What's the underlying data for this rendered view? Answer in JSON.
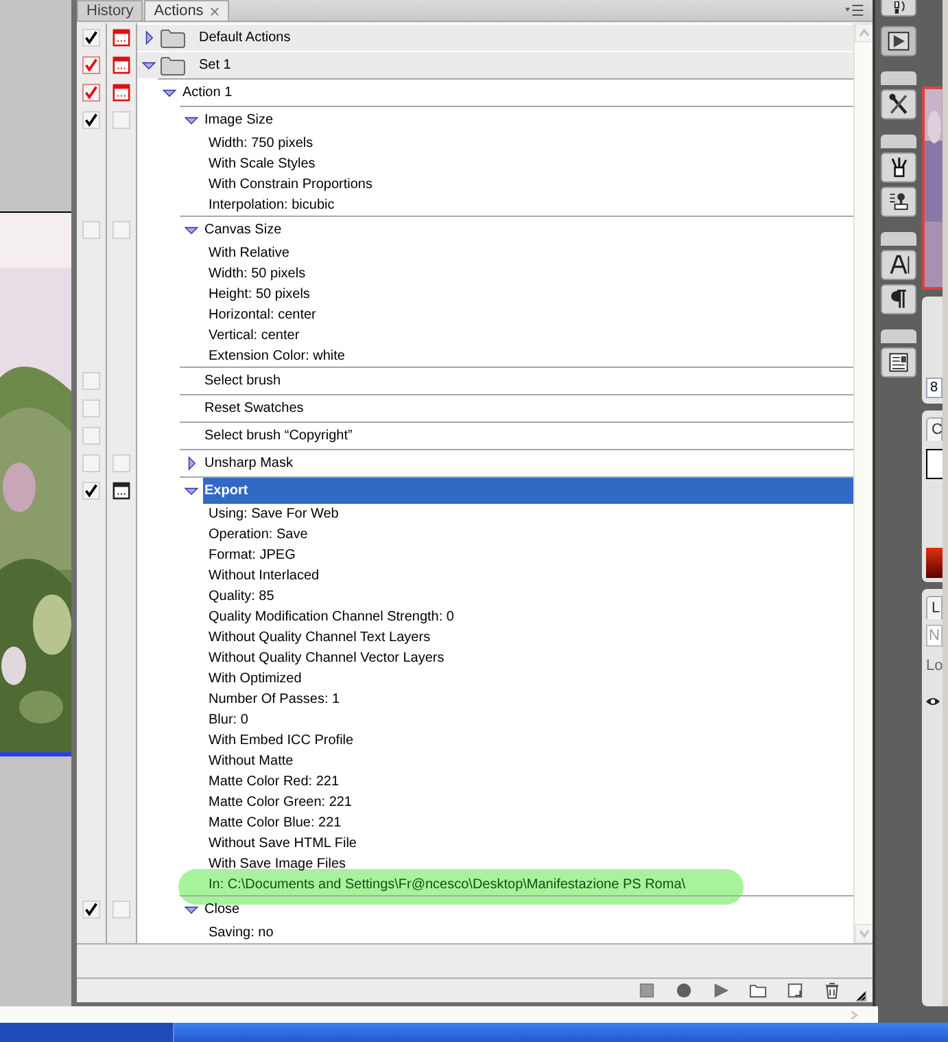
{
  "tabs": [
    {
      "label": "History",
      "selected": false,
      "closable": false
    },
    {
      "label": "Actions",
      "selected": true,
      "closable": true
    }
  ],
  "sets": [
    {
      "name": "Default Actions",
      "checked": true,
      "mixed": false,
      "dialog_toggle": {
        "on": true,
        "mixed": true
      },
      "expanded": false,
      "selected": false
    },
    {
      "name": "Set 1",
      "checked": true,
      "mixed": true,
      "dialog_toggle": {
        "on": true,
        "mixed": true
      },
      "expanded": true,
      "selected": false,
      "children": [
        {
          "name": "Action 1",
          "checked": true,
          "mixed": true,
          "dialog_toggle": {
            "on": true,
            "mixed": true
          },
          "expanded": true,
          "selected": false,
          "children": [
            {
              "name": "Image Size",
              "checked": true,
              "mixed": false,
              "dialog_toggle": {
                "on": false,
                "mixed": false
              },
              "expanded": true,
              "selected": false,
              "params": [
                {
                  "text": "Width: 750 pixels",
                  "highlighted": false
                },
                {
                  "text": "With Scale Styles",
                  "highlighted": false
                },
                {
                  "text": "With Constrain Proportions",
                  "highlighted": false
                },
                {
                  "text": "Interpolation: bicubic",
                  "highlighted": false
                }
              ]
            },
            {
              "name": "Canvas Size",
              "checked": false,
              "mixed": false,
              "dialog_toggle": {
                "on": false,
                "mixed": false
              },
              "expanded": true,
              "selected": false,
              "params": [
                {
                  "text": "With Relative",
                  "highlighted": false
                },
                {
                  "text": "Width: 50 pixels",
                  "highlighted": false
                },
                {
                  "text": "Height: 50 pixels",
                  "highlighted": false
                },
                {
                  "text": "Horizontal: center",
                  "highlighted": false
                },
                {
                  "text": "Vertical: center",
                  "highlighted": false
                },
                {
                  "text": "Extension Color: white",
                  "highlighted": false
                }
              ]
            },
            {
              "name": "Select brush",
              "checked": false,
              "mixed": false,
              "selected": false
            },
            {
              "name": "Reset Swatches",
              "checked": false,
              "mixed": false,
              "selected": false
            },
            {
              "name": "Select brush “Copyright”",
              "checked": false,
              "mixed": false,
              "selected": false
            },
            {
              "name": "Unsharp Mask",
              "checked": false,
              "mixed": false,
              "dialog_toggle": {
                "on": false,
                "mixed": false
              },
              "expanded": false,
              "selected": false
            },
            {
              "name": "Export",
              "checked": true,
              "mixed": false,
              "dialog_toggle": {
                "on": true,
                "mixed": false
              },
              "expanded": true,
              "selected": true,
              "params": [
                {
                  "text": "Using: Save For Web",
                  "highlighted": false
                },
                {
                  "text": "Operation: Save",
                  "highlighted": false
                },
                {
                  "text": "Format: JPEG",
                  "highlighted": false
                },
                {
                  "text": "Without Interlaced",
                  "highlighted": false
                },
                {
                  "text": "Quality: 85",
                  "highlighted": false
                },
                {
                  "text": "Quality Modification Channel Strength: 0",
                  "highlighted": false
                },
                {
                  "text": "Without Quality Channel Text Layers",
                  "highlighted": false
                },
                {
                  "text": "Without Quality Channel Vector Layers",
                  "highlighted": false
                },
                {
                  "text": "With Optimized",
                  "highlighted": false
                },
                {
                  "text": "Number Of Passes: 1",
                  "highlighted": false
                },
                {
                  "text": "Blur: 0",
                  "highlighted": false
                },
                {
                  "text": "With Embed ICC Profile",
                  "highlighted": false
                },
                {
                  "text": "Without Matte",
                  "highlighted": false
                },
                {
                  "text": "Matte Color Red: 221",
                  "highlighted": false
                },
                {
                  "text": "Matte Color Green: 221",
                  "highlighted": false
                },
                {
                  "text": "Matte Color Blue: 221",
                  "highlighted": false
                },
                {
                  "text": "Without Save HTML File",
                  "highlighted": false
                },
                {
                  "text": "With Save Image Files",
                  "highlighted": false
                },
                {
                  "text": "In: C:\\Documents and Settings\\Fr@ncesco\\Desktop\\Manifestazione PS Roma\\",
                  "highlighted": true
                }
              ]
            },
            {
              "name": "Close",
              "checked": true,
              "mixed": false,
              "dialog_toggle": {
                "on": false,
                "mixed": false
              },
              "expanded": true,
              "selected": false,
              "params": [
                {
                  "text": "Saving: no",
                  "highlighted": false
                }
              ]
            }
          ]
        }
      ]
    }
  ],
  "side_panels": {
    "zoom_field": "8",
    "color_tab": "C",
    "layers_tab": "L",
    "blend_field": "N",
    "lock_label": "Lo"
  }
}
